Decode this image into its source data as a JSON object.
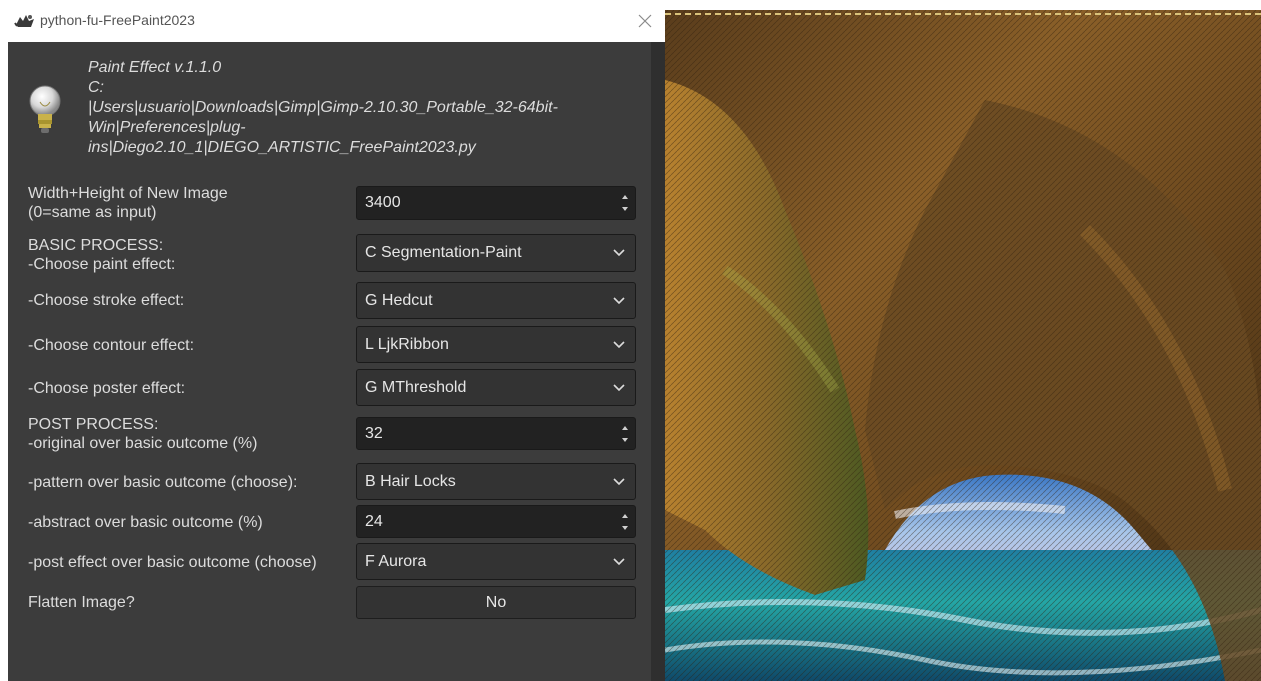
{
  "window": {
    "title": "python-fu-FreePaint2023",
    "close_icon": "close-icon"
  },
  "header": {
    "icon": "lightbulb-icon",
    "lines": [
      "Paint Effect v.1.1.0",
      "C:",
      "|Users|usuario|Downloads|Gimp|Gimp-2.10.30_Portable_32-64bit-",
      "Win|Preferences|plug-",
      "ins|Diego2.10_1|DIEGO_ARTISTIC_FreePaint2023.py"
    ]
  },
  "form": {
    "size": {
      "label_1": "Width+Height of New Image",
      "label_2": " (0=same as input)",
      "value": "3400"
    },
    "paint": {
      "label_1": "BASIC PROCESS:",
      "label_2": " -Choose paint effect:",
      "value": "C Segmentation-Paint"
    },
    "stroke": {
      "label": " -Choose stroke effect:",
      "value": "G Hedcut"
    },
    "contour": {
      "label": " -Choose contour effect:",
      "value": "L LjkRibbon"
    },
    "poster": {
      "label": " -Choose poster effect:",
      "value": "G MThreshold"
    },
    "original": {
      "label_1": "POST PROCESS:",
      "label_2": " -original over basic outcome (%)",
      "value": "32"
    },
    "pattern": {
      "label": "-pattern over basic outcome (choose):",
      "value": "B Hair Locks"
    },
    "abstract": {
      "label": "-abstract over basic outcome (%)",
      "value": "24"
    },
    "post_effect": {
      "label": "-post effect over basic outcome (choose)",
      "value": "F Aurora"
    },
    "flatten": {
      "label": "Flatten Image?",
      "value": "No"
    }
  },
  "colors": {
    "panel_bg": "#3c3c3c",
    "control_bg": "#2b2b2b",
    "text": "#dcdcdc"
  }
}
